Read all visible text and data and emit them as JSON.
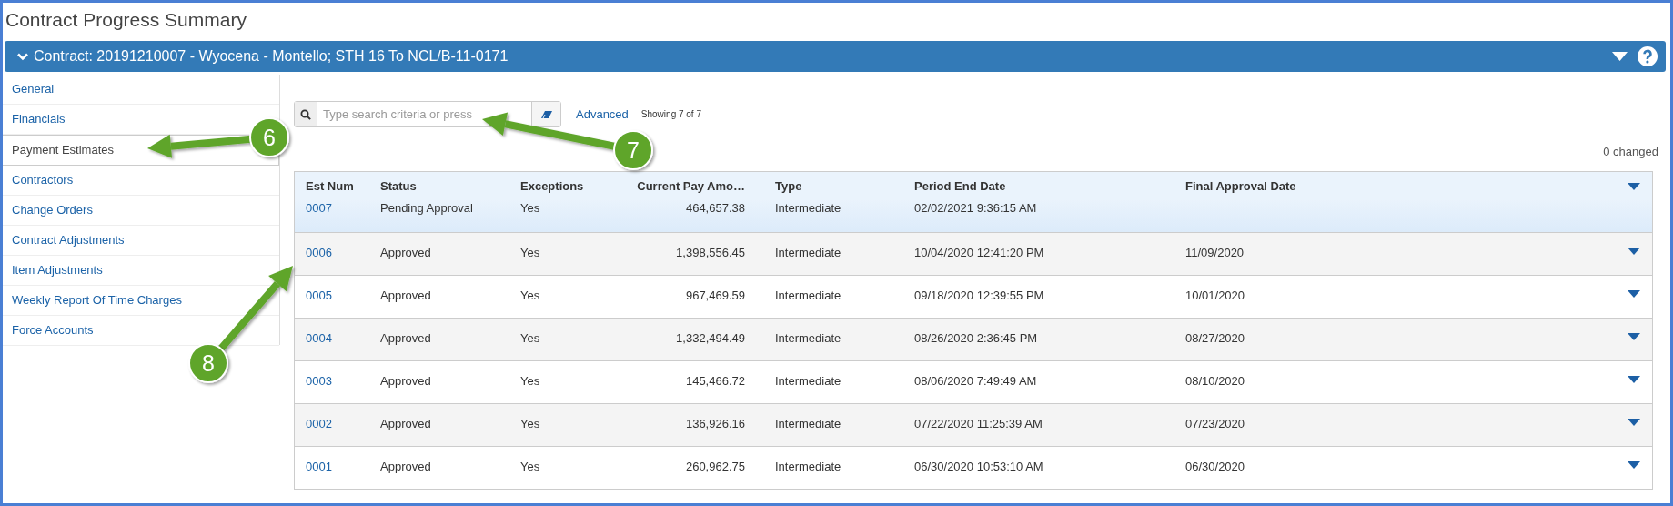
{
  "window": {
    "title": "Contract Progress Summary"
  },
  "header_bar": {
    "title": "Contract: 20191210007 - Wyocena - Montello; STH 16 To NCL/B-11-0171"
  },
  "sidebar": {
    "items": [
      {
        "label": "General",
        "selected": false
      },
      {
        "label": "Financials",
        "selected": false
      },
      {
        "label": "Payment Estimates",
        "selected": true
      },
      {
        "label": "Contractors",
        "selected": false
      },
      {
        "label": "Change Orders",
        "selected": false
      },
      {
        "label": "Contract Adjustments",
        "selected": false
      },
      {
        "label": "Item Adjustments",
        "selected": false
      },
      {
        "label": "Weekly Report Of Time Charges",
        "selected": false
      },
      {
        "label": "Force Accounts",
        "selected": false
      }
    ]
  },
  "search": {
    "placeholder": "Type search criteria or press",
    "advanced": "Advanced",
    "count": "Showing 7 of 7"
  },
  "changed": "0 changed",
  "table": {
    "columns": [
      "Est Num",
      "Status",
      "Exceptions",
      "Current Pay Amo…",
      "Type",
      "Period End Date",
      "Final Approval Date"
    ],
    "rows": [
      {
        "est_num": "0007",
        "status": "Pending Approval",
        "exceptions": "Yes",
        "amount": "464,657.38",
        "type": "Intermediate",
        "period_end": "02/02/2021 9:36:15 AM",
        "final_approval": "",
        "selected": true
      },
      {
        "est_num": "0006",
        "status": "Approved",
        "exceptions": "Yes",
        "amount": "1,398,556.45",
        "type": "Intermediate",
        "period_end": "10/04/2020 12:41:20 PM",
        "final_approval": "11/09/2020",
        "selected": false
      },
      {
        "est_num": "0005",
        "status": "Approved",
        "exceptions": "Yes",
        "amount": "967,469.59",
        "type": "Intermediate",
        "period_end": "09/18/2020 12:39:55 PM",
        "final_approval": "10/01/2020",
        "selected": false
      },
      {
        "est_num": "0004",
        "status": "Approved",
        "exceptions": "Yes",
        "amount": "1,332,494.49",
        "type": "Intermediate",
        "period_end": "08/26/2020 2:36:45 PM",
        "final_approval": "08/27/2020",
        "selected": false
      },
      {
        "est_num": "0003",
        "status": "Approved",
        "exceptions": "Yes",
        "amount": "145,466.72",
        "type": "Intermediate",
        "period_end": "08/06/2020 7:49:49 AM",
        "final_approval": "08/10/2020",
        "selected": false
      },
      {
        "est_num": "0002",
        "status": "Approved",
        "exceptions": "Yes",
        "amount": "136,926.16",
        "type": "Intermediate",
        "period_end": "07/22/2020 11:25:39 AM",
        "final_approval": "07/23/2020",
        "selected": false
      },
      {
        "est_num": "0001",
        "status": "Approved",
        "exceptions": "Yes",
        "amount": "260,962.75",
        "type": "Intermediate",
        "period_end": "06/30/2020 10:53:10 AM",
        "final_approval": "06/30/2020",
        "selected": false
      }
    ]
  },
  "callouts": [
    {
      "number": "6"
    },
    {
      "number": "7"
    },
    {
      "number": "8"
    }
  ]
}
